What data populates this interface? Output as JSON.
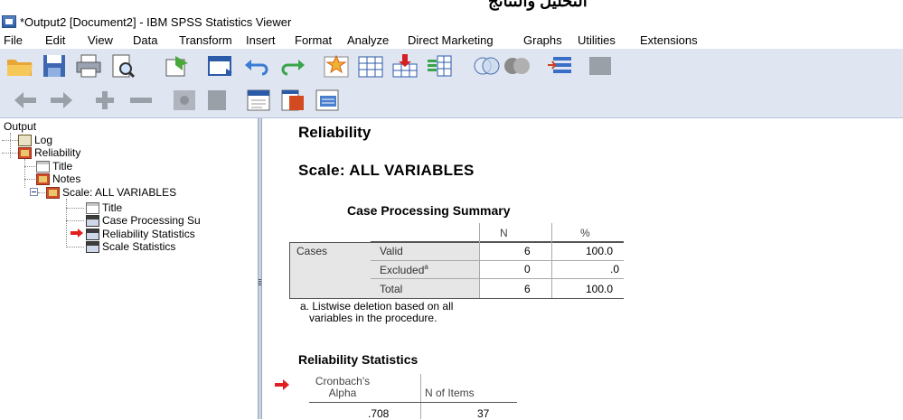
{
  "window": {
    "title": "*Output2 [Document2] - IBM SPSS Statistics Viewer"
  },
  "menu": [
    "File",
    "Edit",
    "View",
    "Data",
    "Transform",
    "Insert",
    "Format",
    "Analyze",
    "Direct Marketing",
    "Graphs",
    "Utilities",
    "Extensions"
  ],
  "toolbar1": [
    "open-folder-icon",
    "save-icon",
    "print-icon",
    "print-preview-icon",
    "export-icon",
    "data-editor-icon",
    "undo-icon",
    "redo-icon",
    "goto-case-icon",
    "goto-variable-icon",
    "insert-cases-icon",
    "insert-variable-icon",
    "venn-icon",
    "balls-icon",
    "variable-sets-icon",
    "extra-icon"
  ],
  "toolbar2": [
    "promote-icon",
    "demote-icon",
    "expand-icon",
    "collapse-icon",
    "show-icon",
    "hide-icon",
    "insert-heading-icon",
    "insert-title-icon",
    "insert-text-icon"
  ],
  "outline": {
    "root": "Output",
    "log": "Log",
    "reliability": "Reliability",
    "title": "Title",
    "notes": "Notes",
    "scale": "Scale: ALL VARIABLES",
    "scale_title": "Title",
    "case_processing": "Case Processing Su",
    "reliability_statistics": "Reliability Statistics",
    "scale_statistics": "Scale Statistics"
  },
  "viewer": {
    "heading": "Reliability",
    "scale_heading": "Scale: ALL VARIABLES",
    "case_table": {
      "title": "Case Processing Summary",
      "col_n": "N",
      "col_pct": "%",
      "row_group": "Cases",
      "rows": [
        {
          "label": "Valid",
          "sup": "",
          "n": "6",
          "pct": "100.0"
        },
        {
          "label": "Excluded",
          "sup": "a",
          "n": "0",
          "pct": ".0"
        },
        {
          "label": "Total",
          "sup": "",
          "n": "6",
          "pct": "100.0"
        }
      ],
      "footnote_line1": "a. Listwise deletion based on all",
      "footnote_line2": "variables in the procedure."
    },
    "rel_table": {
      "title": "Reliability Statistics",
      "col_alpha_1": "Cronbach's",
      "col_alpha_2": "Alpha",
      "col_items": "N of Items",
      "alpha": ".708",
      "items": "37"
    }
  },
  "colors": {
    "toolbar_bg": "#dfe6f1",
    "selected_arrow": "#e02020",
    "table_gray": "#e6e6e6"
  }
}
